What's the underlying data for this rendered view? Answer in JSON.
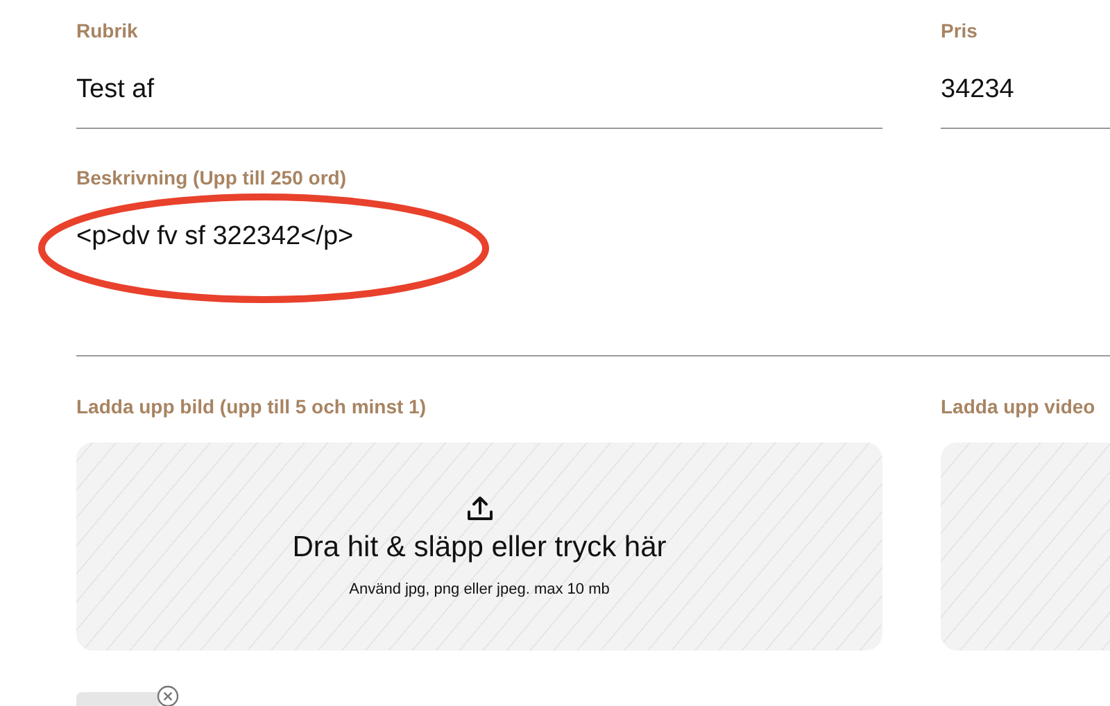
{
  "fields": [
    {
      "label": "Rubrik",
      "value": "Test af"
    },
    {
      "label": "Pris",
      "value": "34234"
    }
  ],
  "description": {
    "label": "Beskrivning (Upp till 250 ord)",
    "value": "<p>dv fv sf 322342</p>"
  },
  "annotation": {
    "kind": "ellipse"
  },
  "uploads": [
    {
      "label": "Ladda upp bild (upp till 5 och minst 1)",
      "prompt": "Dra hit & släpp eller tryck här",
      "hint": "Använd jpg, png eller jpeg. max 10 mb"
    },
    {
      "label": "Ladda upp video"
    }
  ],
  "attachments": [
    {
      "kind": "image"
    }
  ]
}
